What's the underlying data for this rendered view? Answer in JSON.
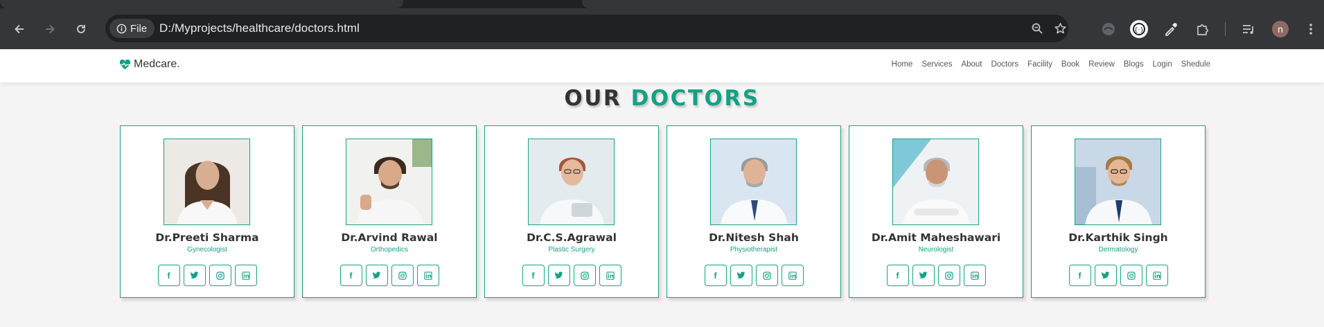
{
  "browser": {
    "chip_label": "File",
    "url": "D:/Myprojects/healthcare/doctors.html",
    "profile_initial": "n"
  },
  "site": {
    "logo_text": "Medcare.",
    "nav": [
      "Home",
      "Services",
      "About",
      "Doctors",
      "Facility",
      "Book",
      "Review",
      "Blogs",
      "Login",
      "Shedule"
    ]
  },
  "section": {
    "title_part1": "OUR",
    "title_part2": "DOCTORS"
  },
  "doctors": [
    {
      "name": "Dr.Preeti Sharma",
      "specialty": "Gynecologist"
    },
    {
      "name": "Dr.Arvind Rawal",
      "specialty": "Orthopedics"
    },
    {
      "name": "Dr.C.S.Agrawal",
      "specialty": "Plastic Surgery"
    },
    {
      "name": "Dr.Nitesh Shah",
      "specialty": "Physiotherapist"
    },
    {
      "name": "Dr.Amit Maheshawari",
      "specialty": "Neurologist"
    },
    {
      "name": "Dr.Karthik Singh",
      "specialty": "Dermatology"
    }
  ],
  "social_icons": [
    "facebook-icon",
    "twitter-icon",
    "instagram-icon",
    "linkedin-icon"
  ],
  "colors": {
    "accent": "#16a085",
    "heading": "#333333",
    "page_bg": "#f4f4f4",
    "chrome_bg": "#35363a"
  }
}
